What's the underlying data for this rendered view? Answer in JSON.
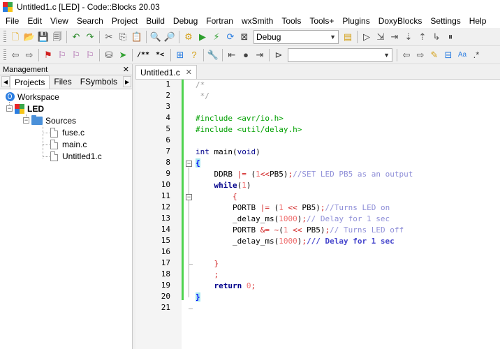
{
  "window": {
    "title": "Untitled1.c [LED] - Code::Blocks 20.03",
    "icon_colors": [
      "#e8262a",
      "#3aa84a",
      "#2a7de1",
      "#f5c518"
    ]
  },
  "menu": [
    "File",
    "Edit",
    "View",
    "Search",
    "Project",
    "Build",
    "Debug",
    "Fortran",
    "wxSmith",
    "Tools",
    "Tools+",
    "Plugins",
    "DoxyBlocks",
    "Settings",
    "Help"
  ],
  "toolbar": {
    "build_target": "Debug",
    "search_value": ""
  },
  "management": {
    "title": "Management",
    "close_glyph": "✕",
    "tabs": [
      "Projects",
      "Files",
      "FSymbols"
    ],
    "active_tab": "Projects",
    "tree": {
      "workspace": "Workspace",
      "project": "LED",
      "folder": "Sources",
      "files": [
        "fuse.c",
        "main.c",
        "Untitled1.c"
      ]
    }
  },
  "editor": {
    "tab_label": "Untitled1.c",
    "tab_close": "✕",
    "line_numbers": [
      "1",
      "2",
      "3",
      "4",
      "5",
      "6",
      "7",
      "8",
      "9",
      "10",
      "11",
      "12",
      "13",
      "14",
      "15",
      "16",
      "17",
      "18",
      "19",
      "20",
      "21"
    ]
  },
  "colors": {
    "change_bar": "#4ed34e",
    "comment": "#a0a0a0",
    "preprocessor": "#00a000",
    "keyword": "#00008b",
    "number": "#f07070",
    "brace_highlight": "#a8e8f0"
  }
}
